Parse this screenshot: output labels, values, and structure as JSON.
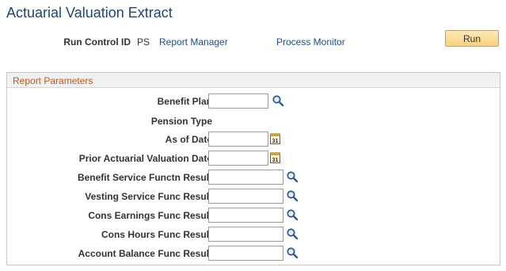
{
  "page": {
    "title": "Actuarial Valuation Extract"
  },
  "run_control": {
    "label": "Run Control ID",
    "value": "PS",
    "report_manager": "Report Manager",
    "process_monitor": "Process Monitor",
    "run_button": "Run"
  },
  "section": {
    "title": "Report Parameters",
    "fields": {
      "benefit_plan": {
        "label": "Benefit Plan",
        "value": ""
      },
      "pension_type": {
        "label": "Pension Type"
      },
      "as_of_date": {
        "label": "As of Date",
        "value": ""
      },
      "prior_valuation_date": {
        "label": "Prior Actuarial Valuation Date",
        "value": ""
      },
      "benefit_service": {
        "label": "Benefit Service Functn Result",
        "value": ""
      },
      "vesting_service": {
        "label": "Vesting Service Func Result",
        "value": ""
      },
      "cons_earnings": {
        "label": "Cons Earnings Func Result",
        "value": ""
      },
      "cons_hours": {
        "label": "Cons Hours Func Result",
        "value": ""
      },
      "account_balance": {
        "label": "Account Balance Func Result",
        "value": ""
      }
    }
  },
  "icons": {
    "lookup": "magnifier-lookup-icon",
    "calendar": "calendar-icon",
    "calendar_glyph": "31"
  },
  "colors": {
    "title": "#1c4679",
    "link": "#1a4d8f",
    "section_title": "#b35a1f",
    "button_top": "#fde9b9",
    "button_bottom": "#f7d27c"
  }
}
